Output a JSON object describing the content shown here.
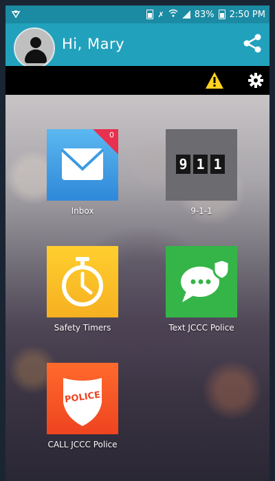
{
  "status_bar": {
    "battery_percent": "83%",
    "time": "2:50 PM",
    "icons": [
      "alarm-icon",
      "mute-icon",
      "wifi-icon",
      "signal-icon",
      "battery-icon"
    ]
  },
  "header": {
    "greeting": "Hi, Mary",
    "avatar_icon": "person-icon",
    "share_icon": "share-icon"
  },
  "toolbar": {
    "warning_icon": "warning-icon",
    "settings_icon": "gear-icon"
  },
  "tiles": [
    {
      "label": "Inbox",
      "badge": "0",
      "icon": "envelope-icon",
      "color": "#3a9be3"
    },
    {
      "label": "9-1-1",
      "digits": [
        "9",
        "1",
        "1"
      ],
      "icon": "911-digits-icon",
      "color": "#6b6b70"
    },
    {
      "label": "Safety Timers",
      "icon": "stopwatch-icon",
      "color": "#f9c02a"
    },
    {
      "label": "Text JCCC Police",
      "icon": "chat-shield-icon",
      "color": "#35b548"
    },
    {
      "label": "CALL JCCC Police",
      "icon": "police-badge-icon",
      "badge_text": "POLICE",
      "color": "#f25a28"
    }
  ],
  "colors": {
    "status_bar": "#1b8aa3",
    "header": "#22a1bd",
    "toolbar": "#000000",
    "warning": "#ffd21f",
    "badge": "#e8304f"
  }
}
